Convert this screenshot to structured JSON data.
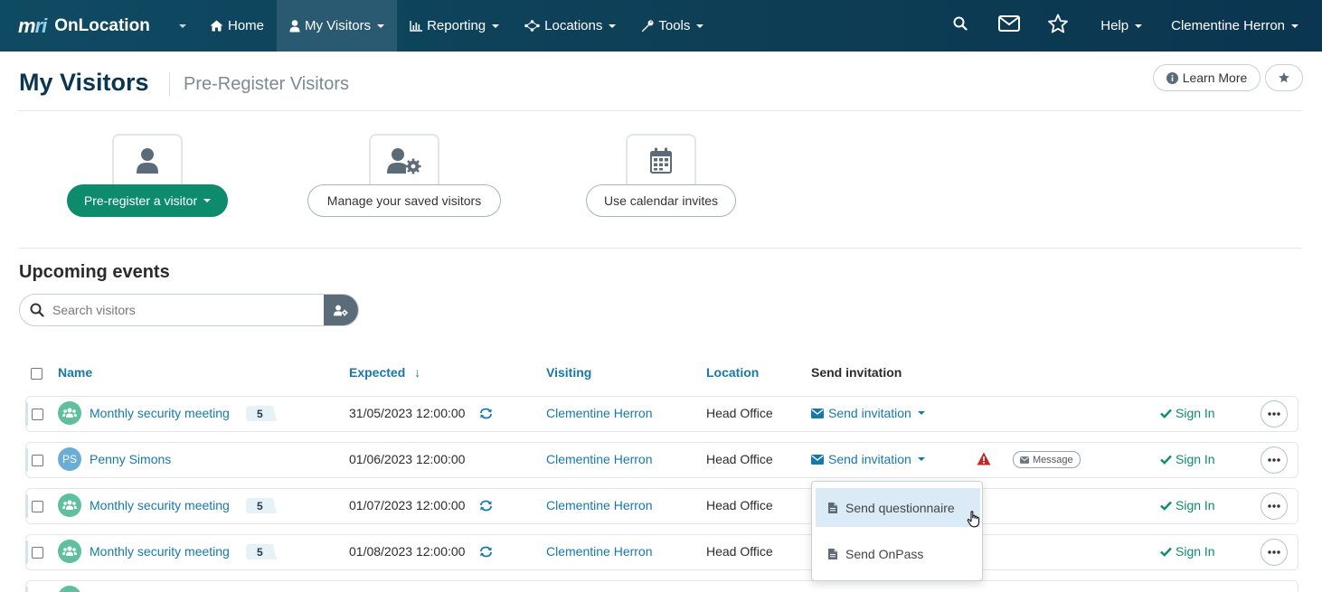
{
  "nav": {
    "brand_logo_a": "m",
    "brand_logo_b": "ri",
    "brand_name": "OnLocation",
    "items": [
      {
        "label": "Home",
        "icon": "home-icon"
      },
      {
        "label": "My Visitors",
        "icon": "user-icon",
        "active": true
      },
      {
        "label": "Reporting",
        "icon": "chart-icon"
      },
      {
        "label": "Locations",
        "icon": "network-icon"
      },
      {
        "label": "Tools",
        "icon": "wrench-icon"
      }
    ],
    "help_label": "Help",
    "user_name": "Clementine Herron"
  },
  "header": {
    "title": "My Visitors",
    "subtitle": "Pre-Register Visitors",
    "learn_more_label": "Learn More"
  },
  "actions": {
    "preregister_label": "Pre-register a visitor",
    "manage_label": "Manage your saved visitors",
    "calendar_label": "Use calendar invites"
  },
  "upcoming": {
    "title": "Upcoming events",
    "search_placeholder": "Search visitors"
  },
  "table": {
    "columns": {
      "name": "Name",
      "expected": "Expected",
      "sort_arrow": "↓",
      "visiting": "Visiting",
      "location": "Location",
      "send_invitation": "Send invitation"
    },
    "rows": [
      {
        "name": "Monthly security meeting",
        "type": "group",
        "count": "5",
        "expected": "31/05/2023 12:00:00",
        "recurring": true,
        "visiting": "Clementine Herron",
        "location": "Head Office",
        "invite_label": "Send invitation",
        "sign_in": "Sign In"
      },
      {
        "name": "Penny Simons",
        "type": "person",
        "initials": "PS",
        "expected": "01/06/2023 12:00:00",
        "recurring": false,
        "visiting": "Clementine Herron",
        "location": "Head Office",
        "invite_label": "Send invitation",
        "message_label": "Message",
        "sign_in": "Sign In"
      },
      {
        "name": "Monthly security meeting",
        "type": "group",
        "count": "5",
        "expected": "01/07/2023 12:00:00",
        "recurring": true,
        "visiting": "Clementine Herron",
        "location": "Head Office",
        "sign_in": "Sign In"
      },
      {
        "name": "Monthly security meeting",
        "type": "group",
        "count": "5",
        "expected": "01/08/2023 12:00:00",
        "recurring": true,
        "visiting": "Clementine Herron",
        "location": "Head Office",
        "sign_in": "Sign In"
      }
    ]
  },
  "dropdown": {
    "items": [
      {
        "label": "Send questionnaire",
        "hovered": true
      },
      {
        "label": "Send OnPass"
      }
    ]
  },
  "colors": {
    "nav_bg": "#0d3d55",
    "link": "#1679a8",
    "primary_green": "#0e8a6c",
    "title_navy": "#0b3550",
    "warning_red": "#c62828"
  }
}
